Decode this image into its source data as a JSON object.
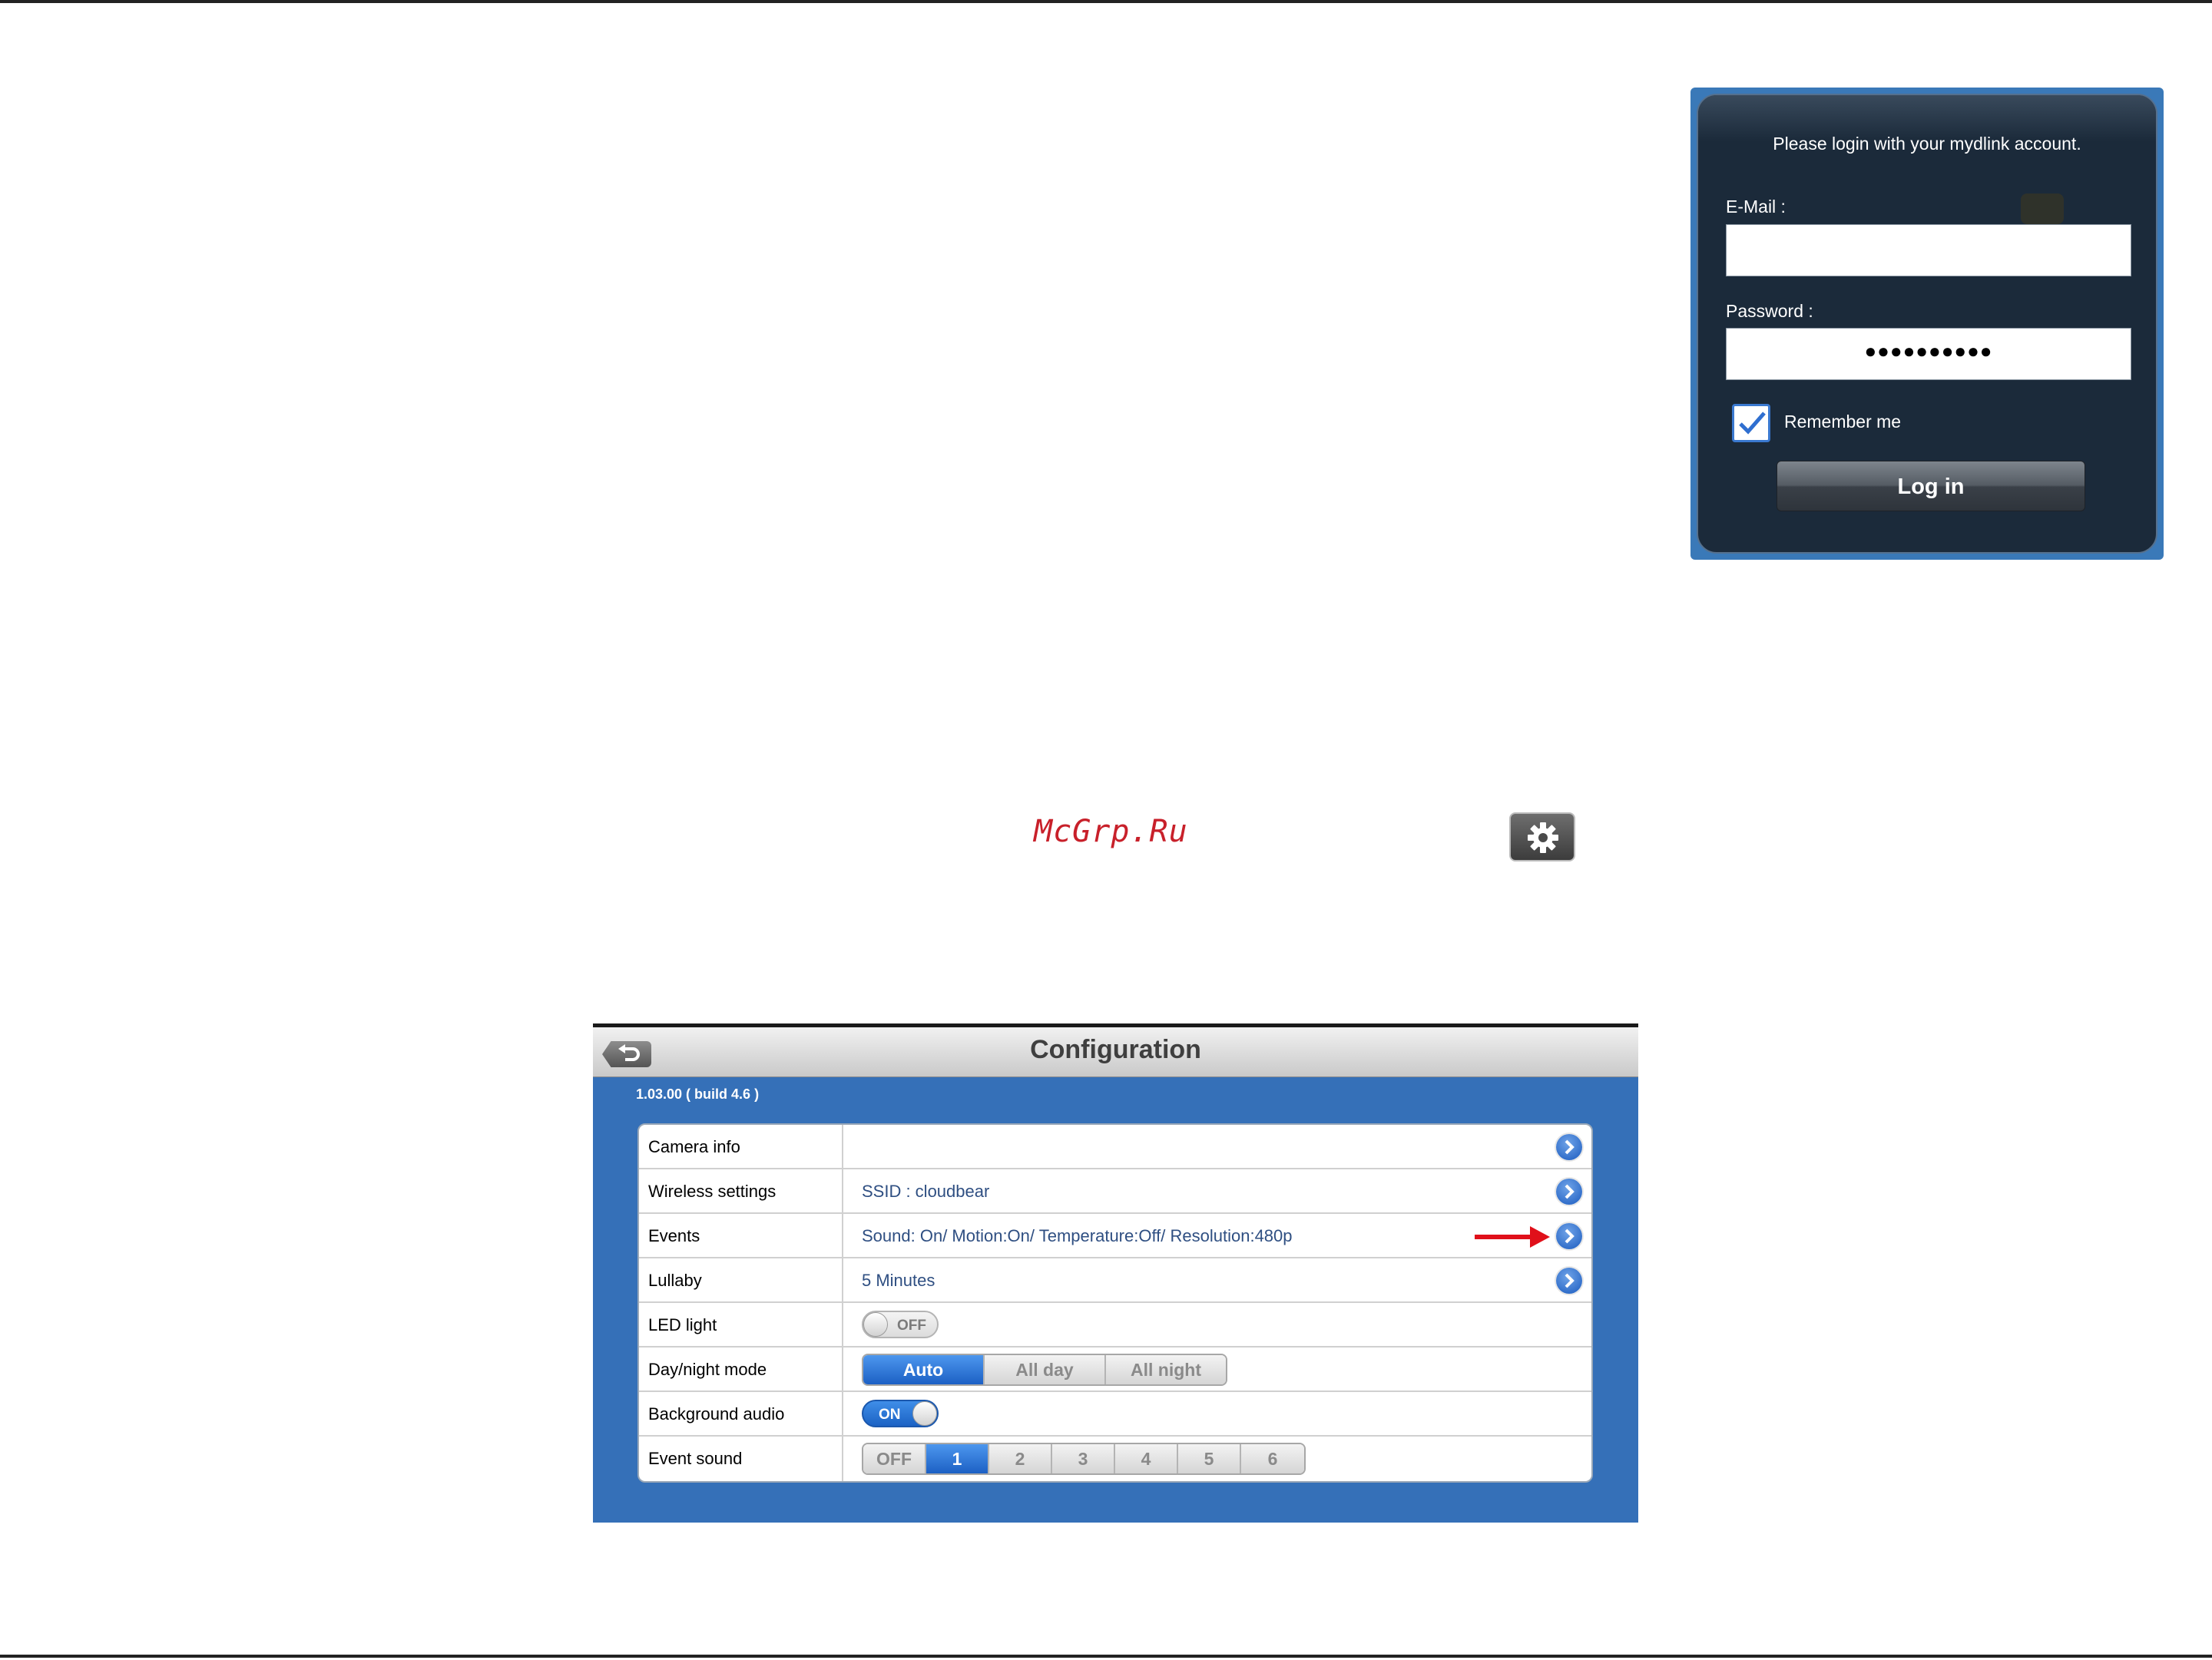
{
  "login": {
    "message": "Please login with your mydlink account.",
    "email_label": "E-Mail :",
    "email_value": "",
    "password_label": "Password :",
    "password_value": "●●●●●●●●●●",
    "remember_label": "Remember me",
    "remember_checked": true,
    "login_button": "Log in"
  },
  "watermark": "McGrp.Ru",
  "config": {
    "title": "Configuration",
    "version": "1.03.00 ( build 4.6 )",
    "rows": [
      {
        "label": "Camera info",
        "value": ""
      },
      {
        "label": "Wireless settings",
        "value": "SSID : cloudbear"
      },
      {
        "label": "Events",
        "value": "Sound: On/ Motion:On/ Temperature:Off/ Resolution:480p"
      },
      {
        "label": "Lullaby",
        "value": "5 Minutes"
      },
      {
        "label": "LED light",
        "toggle": "OFF"
      },
      {
        "label": "Day/night mode",
        "options": [
          "Auto",
          "All day",
          "All night"
        ],
        "selected": "Auto"
      },
      {
        "label": "Background audio",
        "toggle": "ON"
      },
      {
        "label": "Event sound",
        "options": [
          "OFF",
          "1",
          "2",
          "3",
          "4",
          "5",
          "6"
        ],
        "selected": "1"
      }
    ]
  },
  "colors": {
    "config_background": "#3570b8",
    "login_background": "#1b2a3a",
    "accent_blue": "#1c60c4",
    "arrow_red": "#e0101a",
    "watermark_red": "#c8202a"
  }
}
